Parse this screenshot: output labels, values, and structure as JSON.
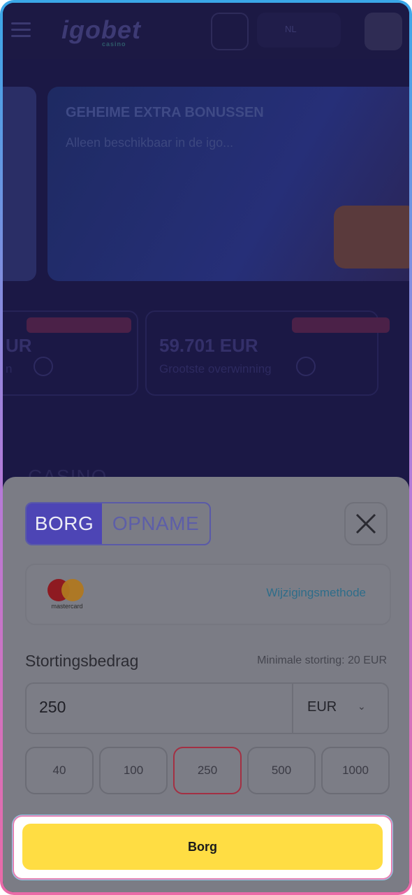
{
  "header": {
    "logo": "igobet",
    "logo_tag": "casino",
    "language_label": "NL"
  },
  "banner": {
    "title": "GEHEIME EXTRA BONUSSEN",
    "subtitle": "Alleen beschikbaar in de igo..."
  },
  "stats": [
    {
      "value": "UR",
      "label": "n"
    },
    {
      "value": "59.701 EUR",
      "label": "Grootste overwinning"
    }
  ],
  "section_title": "CASINO",
  "modal": {
    "tabs": [
      {
        "label": "BORG",
        "active": true
      },
      {
        "label": "OPNAME",
        "active": false
      }
    ],
    "payment_method": {
      "brand": "mastercard",
      "change_label": "Wijzigingsmethode"
    },
    "amount_label": "Stortingsbedrag",
    "min_deposit": "Minimale storting: 20 EUR",
    "amount_value": "250",
    "currency": "EUR",
    "presets": [
      "40",
      "100",
      "250",
      "500",
      "1000"
    ],
    "selected_preset": "250",
    "submit_label": "Borg"
  },
  "colors": {
    "accent": "#4d45b5",
    "submit": "#ffdd43",
    "selected_border": "#a33043"
  }
}
